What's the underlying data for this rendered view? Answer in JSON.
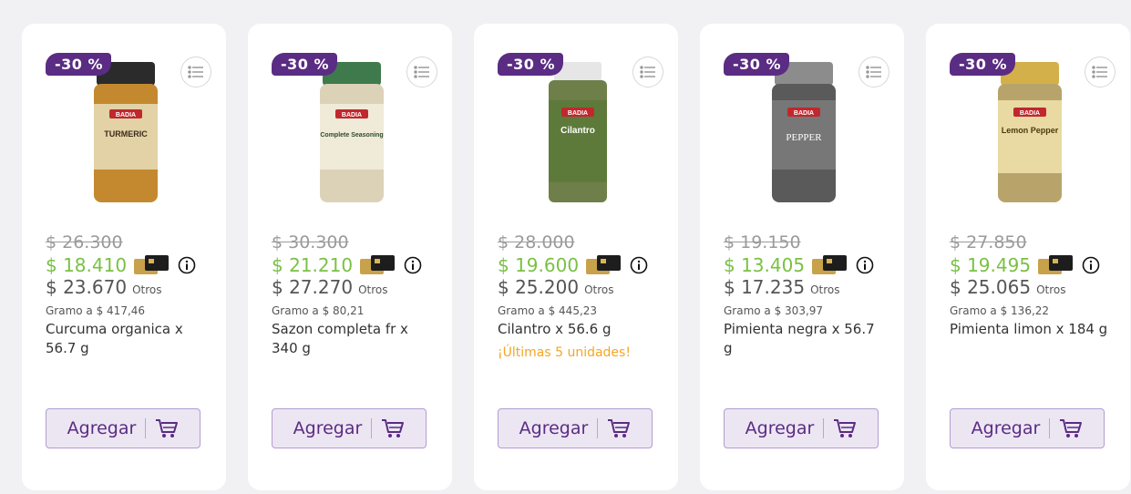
{
  "products": [
    {
      "discount": "-30 %",
      "old_price": "$ 26.300",
      "price": "$ 18.410",
      "other_price": "$ 23.670",
      "other_label": "Otros",
      "unit_price": "Gramo a $ 417,46",
      "name": "Curcuma organica x 56.7 g",
      "stock": "",
      "add_label": "Agregar",
      "image": {
        "brand": "BADIA",
        "label": "TURMERIC",
        "cap": "#2b2b2b",
        "jar": "#c4892e",
        "band": "#e3d2a6"
      }
    },
    {
      "discount": "-30 %",
      "old_price": "$ 30.300",
      "price": "$ 21.210",
      "other_price": "$ 27.270",
      "other_label": "Otros",
      "unit_price": "Gramo a $ 80,21",
      "name": "Sazon completa fr x 340 g",
      "stock": "",
      "add_label": "Agregar",
      "image": {
        "brand": "BADIA",
        "label": "Complete Seasoning",
        "cap": "#3f7a4c",
        "jar": "#dcd2b8",
        "band": "#f0ead8"
      }
    },
    {
      "discount": "-30 %",
      "old_price": "$ 28.000",
      "price": "$ 19.600",
      "other_price": "$ 25.200",
      "other_label": "Otros",
      "unit_price": "Gramo a $ 445,23",
      "name": "Cilantro x 56.6 g",
      "stock": "¡Últimas 5 unidades!",
      "add_label": "Agregar",
      "image": {
        "brand": "BADIA",
        "label": "Cilantro",
        "cap": "#e6e6e6",
        "jar": "#6e7f4a",
        "band": "#5d7a3a"
      }
    },
    {
      "discount": "-30 %",
      "old_price": "$ 19.150",
      "price": "$ 13.405",
      "other_price": "$ 17.235",
      "other_label": "Otros",
      "unit_price": "Gramo a $ 303,97",
      "name": "Pimienta negra x 56.7 g",
      "stock": "",
      "add_label": "Agregar",
      "image": {
        "brand": "BADIA",
        "label": "PEPPER",
        "cap": "#8c8c8c",
        "jar": "#5a5a5a",
        "band": "#777777"
      }
    },
    {
      "discount": "-30 %",
      "old_price": "$ 27.850",
      "price": "$ 19.495",
      "other_price": "$ 25.065",
      "other_label": "Otros",
      "unit_price": "Gramo a $ 136,22",
      "name": "Pimienta limon x 184 g",
      "stock": "",
      "add_label": "Agregar",
      "image": {
        "brand": "BADIA",
        "label": "Lemon Pepper",
        "cap": "#d4b04a",
        "jar": "#b8a46a",
        "band": "#e9d9a2"
      }
    }
  ],
  "colors": {
    "badge": "#5b2c83",
    "price_green": "#7ac143",
    "stock_orange": "#f5a623",
    "button_bg": "#ece6f3",
    "button_border": "#b39cd0"
  },
  "icons": {
    "menu": "list-menu-icon",
    "card": "payment-card-icon",
    "info": "info-icon",
    "cart": "cart-icon"
  }
}
